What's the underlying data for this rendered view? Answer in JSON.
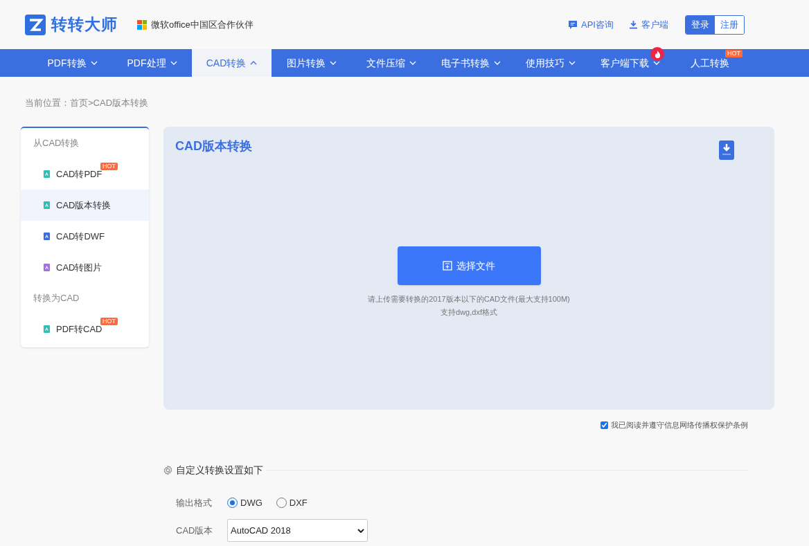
{
  "header": {
    "logo_text": "转转大师",
    "partner": "微软office中国区合作伙伴",
    "links": [
      {
        "kind": "api",
        "label": "API咨询"
      },
      {
        "kind": "download",
        "label": "客户端"
      }
    ],
    "auth": [
      {
        "label": "登录",
        "selected": true
      },
      {
        "label": "注册",
        "selected": false
      }
    ]
  },
  "nav": [
    {
      "label": "PDF转换",
      "selected": false,
      "expanded": false
    },
    {
      "label": "PDF处理",
      "selected": false,
      "expanded": false
    },
    {
      "label": "CAD转换",
      "selected": true,
      "expanded": true
    },
    {
      "label": "图片转换",
      "selected": false,
      "expanded": false
    },
    {
      "label": "文件压缩",
      "selected": false,
      "expanded": false
    },
    {
      "label": "电子书转换",
      "selected": false,
      "expanded": false
    },
    {
      "label": "使用技巧",
      "selected": false,
      "expanded": false
    },
    {
      "label": "客户端下载",
      "selected": false,
      "expanded": false,
      "badge": {
        "kind": "fire"
      }
    },
    {
      "label": "人工转换",
      "selected": false,
      "badge": {
        "kind": "hot",
        "text": "HOT"
      }
    }
  ],
  "breadcrumb": "当前位置：首页>CAD版本转换",
  "sidebar": [
    {
      "heading": "从CAD转换",
      "items": [
        {
          "label": "CAD转PDF",
          "selected": false,
          "color": "#2fbfb3",
          "badge": "HOT"
        },
        {
          "label": "CAD版本转换",
          "selected": true,
          "color": "#2fbfb3"
        },
        {
          "label": "CAD转DWF",
          "selected": false,
          "color": "#3b6fe0"
        },
        {
          "label": "CAD转图片",
          "selected": false,
          "color": "#a070e8"
        }
      ]
    },
    {
      "heading": "转换为CAD",
      "items": [
        {
          "label": "PDF转CAD",
          "selected": false,
          "color": "#2fbfb3",
          "badge": "HOT"
        }
      ]
    }
  ],
  "upload": {
    "title": "CAD版本转换",
    "button": "选择文件",
    "hint": "请上传需要转换的2017版本以下的CAD文件(最大支持100M)",
    "formats": "支持dwg,dxf格式"
  },
  "agreement": {
    "checked": true,
    "label": "我已阅读并遵守信息网络传播权保护条例"
  },
  "settings": {
    "title": "自定义转换设置如下",
    "output_label": "输出格式",
    "formats": [
      {
        "label": "DWG",
        "selected": true
      },
      {
        "label": "DXF",
        "selected": false
      }
    ],
    "version_label": "CAD版本",
    "version_value": "AutoCAD 2018"
  }
}
